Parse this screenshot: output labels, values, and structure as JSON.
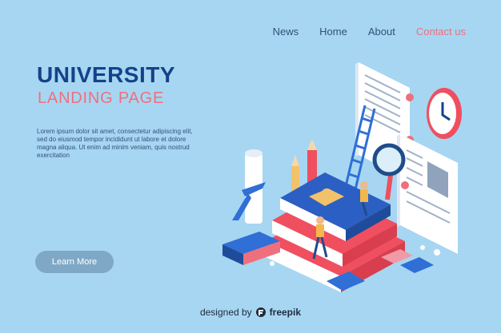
{
  "nav": {
    "items": [
      "News",
      "Home",
      "About",
      "Contact us"
    ]
  },
  "hero": {
    "title": "UNIVERSITY",
    "subtitle": "LANDING PAGE",
    "body": "Lorem ipsum dolor sit amet, consectetur adipiscing elit, sed do eiusmod tempor incididunt ut labore et dolore magna aliqua. Ut enim ad minim veniam, quis nostrud exercitation",
    "button_label": "Learn More"
  },
  "footer": {
    "designed_by": "designed by",
    "brand": "freepik"
  },
  "colors": {
    "background": "#a7d6f2",
    "title": "#14428a",
    "accent": "#ef6f7d",
    "button": "#7fa8c7"
  },
  "icons": [
    "clock-icon",
    "document-icon",
    "magnifier-icon",
    "ladder-icon",
    "pencil-icon",
    "diploma-icon",
    "books-icon",
    "puzzle-icon",
    "eraser-icon",
    "freepik-logo-icon"
  ]
}
